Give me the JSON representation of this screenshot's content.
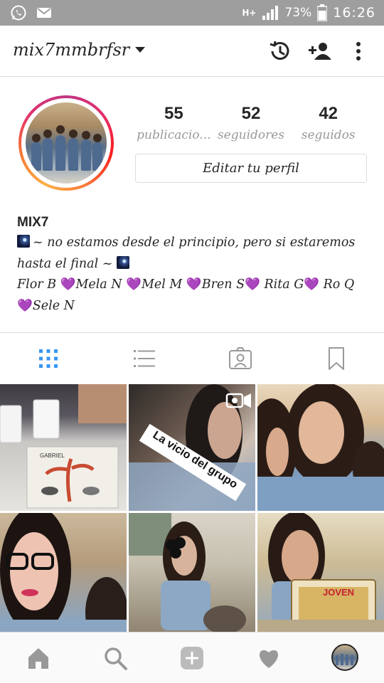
{
  "status_bar": {
    "network": "H+",
    "battery_percent": "73%",
    "time": "16:26",
    "icons": [
      "whatsapp-icon",
      "gmail-icon",
      "signal-icon",
      "battery-icon"
    ]
  },
  "header": {
    "username": "mix7mmbrfsr",
    "icons": [
      "history-icon",
      "add-person-icon",
      "more-vertical-icon"
    ]
  },
  "profile": {
    "stats": [
      {
        "value": "55",
        "label": "publicacio..."
      },
      {
        "value": "52",
        "label": "seguidores"
      },
      {
        "value": "42",
        "label": "seguidos"
      }
    ],
    "edit_button": "Editar tu perfil",
    "name": "MIX7",
    "bio": {
      "line1": "~ no estamos desde el principio, pero si estaremos",
      "line2_text": "hasta el final ~",
      "line3_parts": [
        "Flor B ",
        "Mela N ",
        "Mel M ",
        "Bren S",
        " Rita G",
        " Ro Q"
      ],
      "line4_text": "Sele N",
      "heart": "💜"
    }
  },
  "tabs": [
    "grid-view-icon",
    "list-view-icon",
    "tagged-photos-icon",
    "saved-icon"
  ],
  "grid": {
    "posts": [
      {
        "type": "photo"
      },
      {
        "type": "video",
        "caption": "La vicio del grupo"
      },
      {
        "type": "photo"
      },
      {
        "type": "photo"
      },
      {
        "type": "photo"
      },
      {
        "type": "photo",
        "book_label": "JOVEN"
      }
    ]
  },
  "bottom_nav": [
    "home-icon",
    "search-icon",
    "new-post-icon",
    "activity-heart-icon",
    "profile-avatar-icon"
  ],
  "colors": {
    "accent_blue": "#3897f0",
    "heart_purple": "#9b30d9",
    "status_bar_gray": "#9e9e9e",
    "muted_text": "#999999"
  }
}
